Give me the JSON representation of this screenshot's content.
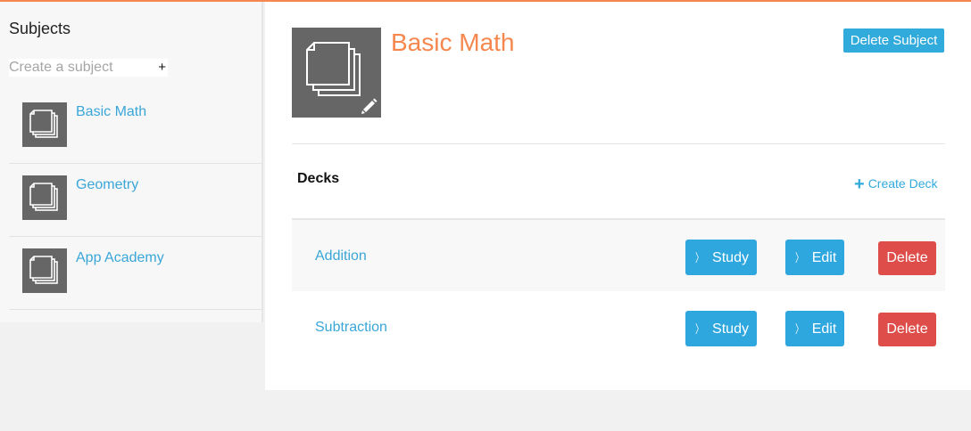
{
  "colors": {
    "accent_orange": "#f5874f",
    "link_blue": "#3aa6d8",
    "button_blue": "#2ea6de",
    "delete_red": "#de4d49",
    "thumb_gray": "#666666"
  },
  "sidebar": {
    "title": "Subjects",
    "create_placeholder": "Create a subject",
    "create_button": "+",
    "subjects": [
      {
        "name": "Basic Math",
        "icon": "stacked-cards-icon"
      },
      {
        "name": "Geometry",
        "icon": "stacked-cards-icon"
      },
      {
        "name": "App Academy",
        "icon": "stacked-cards-icon"
      }
    ]
  },
  "main": {
    "subject_title": "Basic Math",
    "subject_icon": "stacked-cards-icon",
    "edit_icon": "pencil-icon",
    "delete_subject_label": "Delete Subject",
    "decks_heading": "Decks",
    "create_deck_label": "Create Deck",
    "create_deck_icon": "+",
    "decks": [
      {
        "name": "Addition",
        "study_label": "Study",
        "edit_label": "Edit",
        "delete_label": "Delete"
      },
      {
        "name": "Subtraction",
        "study_label": "Study",
        "edit_label": "Edit",
        "delete_label": "Delete"
      }
    ]
  }
}
